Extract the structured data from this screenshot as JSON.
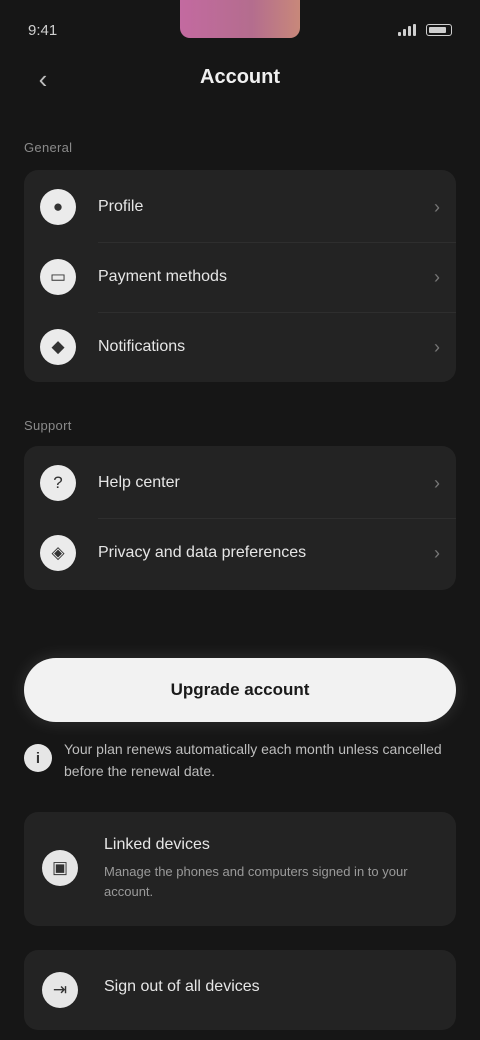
{
  "status": {
    "time": "9:41"
  },
  "header": {
    "name": "Account"
  },
  "sections": [
    {
      "label": "General",
      "items": [
        {
          "label": "Profile",
          "icon": "person-icon"
        },
        {
          "label": "Payment methods",
          "icon": "card-icon"
        },
        {
          "label": "Notifications",
          "icon": "bell-icon"
        }
      ]
    },
    {
      "label": "Support",
      "items": [
        {
          "label": "Help center",
          "icon": "help-icon"
        },
        {
          "label": "Privacy and data preferences",
          "icon": "shield-icon"
        }
      ]
    }
  ],
  "cta": {
    "label": "Upgrade account"
  },
  "note": {
    "text": "Your plan renews automatically each month unless cancelled before the renewal date."
  },
  "extra_cards": [
    {
      "title": "Linked devices",
      "subtitle": "Manage the phones and computers signed in to your account."
    },
    {
      "title": "Sign out of all devices",
      "subtitle": ""
    }
  ],
  "colors": {
    "background": "#161616",
    "card": "#232323",
    "accent_gradient_start": "#c36aa0",
    "cta": "#f2f2f2"
  }
}
